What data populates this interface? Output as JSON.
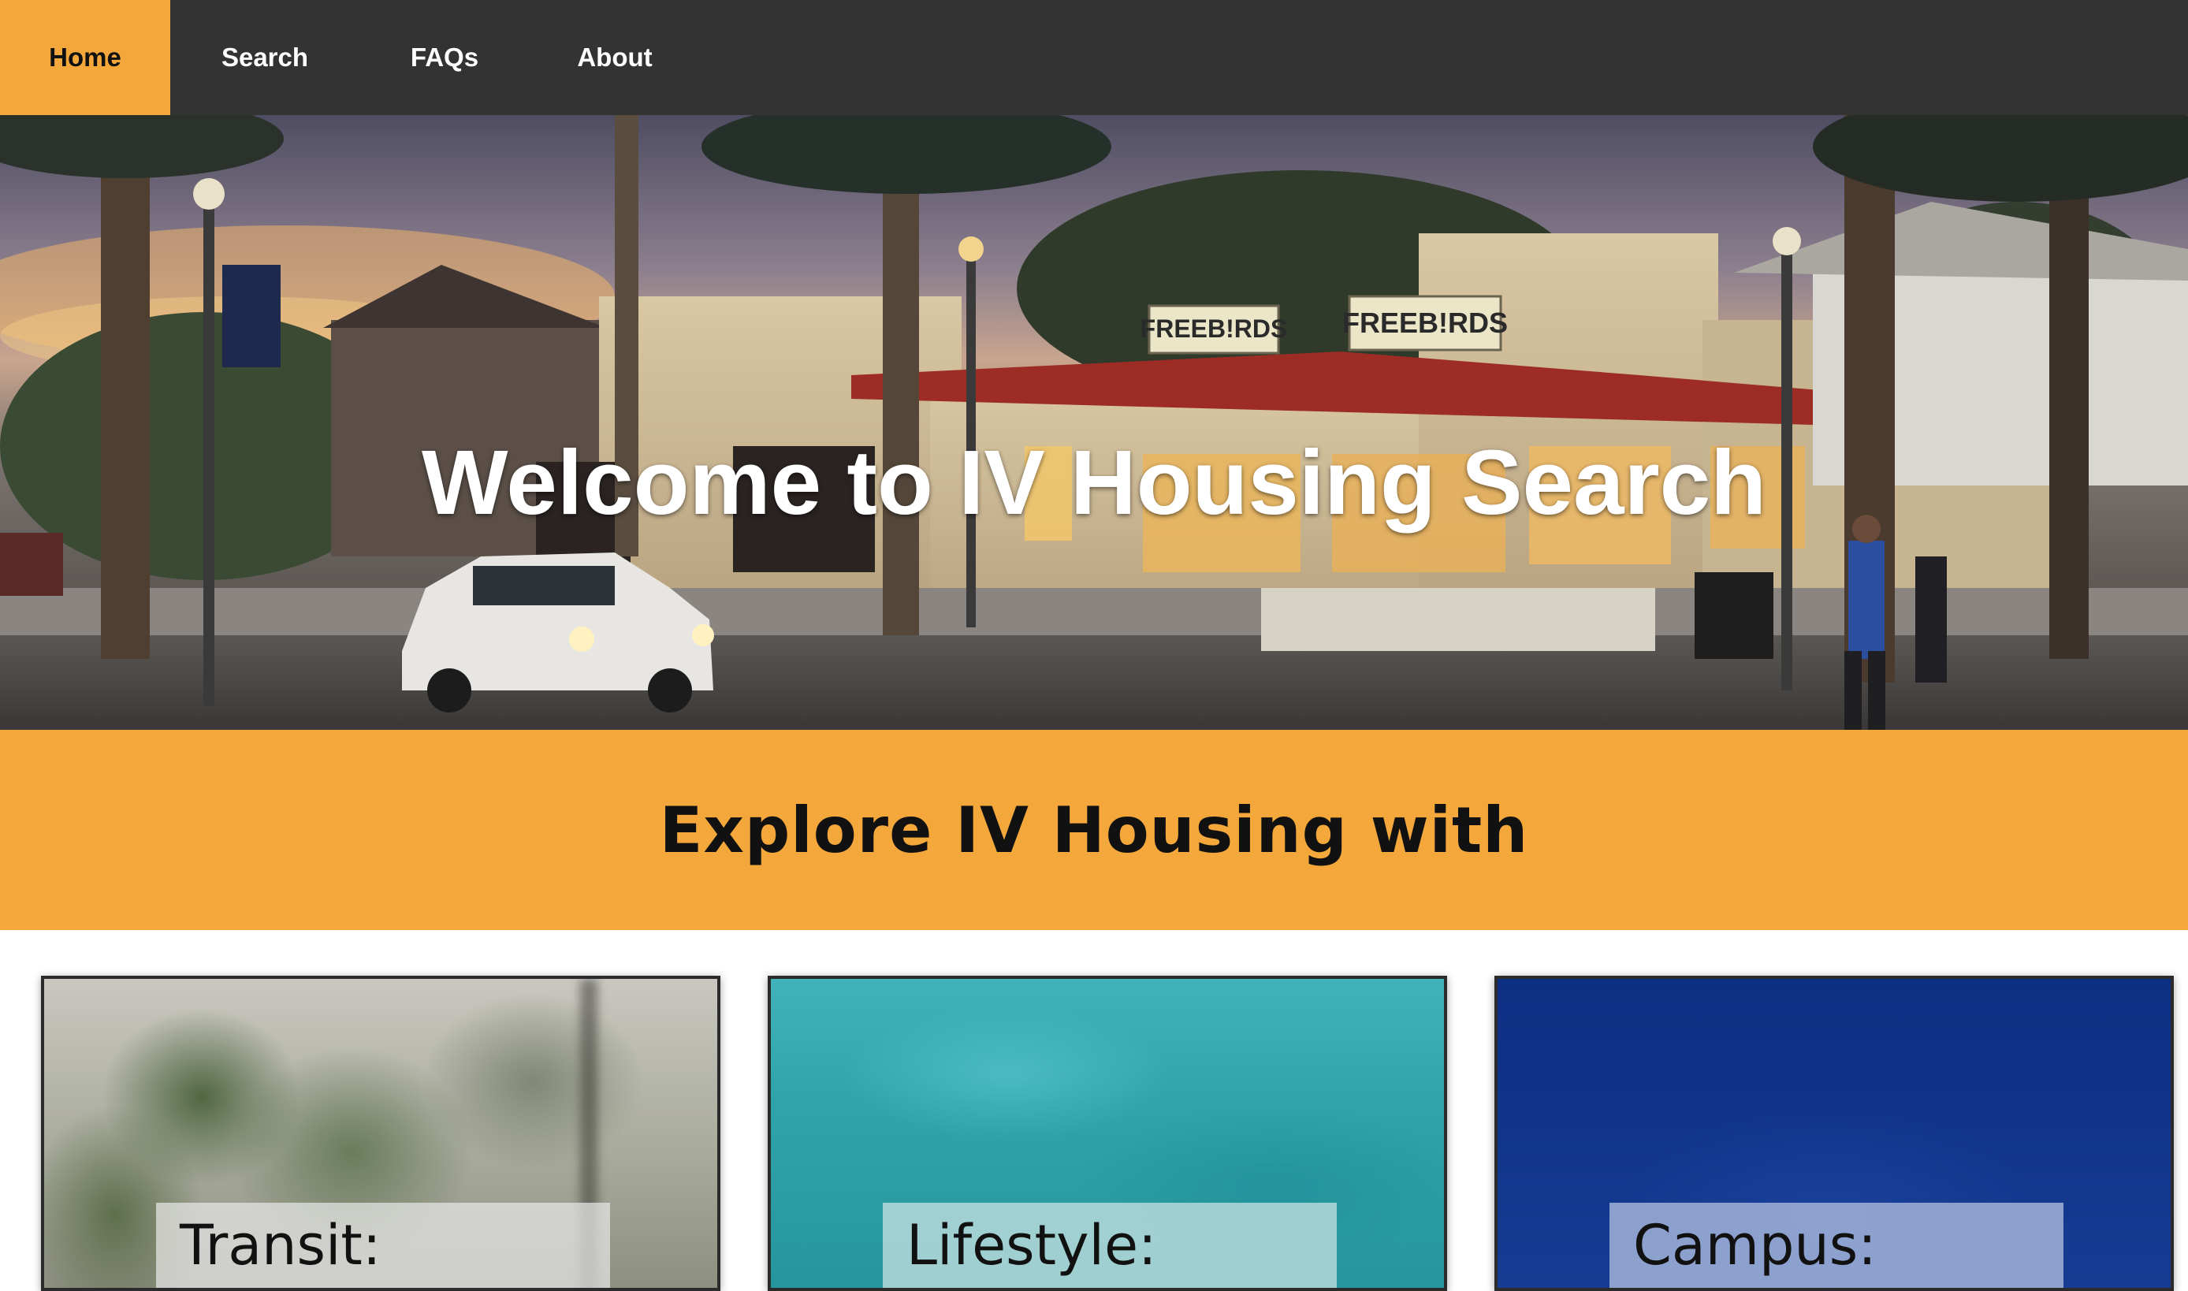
{
  "nav": {
    "items": [
      {
        "label": "Home",
        "active": true
      },
      {
        "label": "Search",
        "active": false
      },
      {
        "label": "FAQs",
        "active": false
      },
      {
        "label": "About",
        "active": false
      }
    ]
  },
  "hero": {
    "title": "Welcome to IV Housing Search",
    "signs": [
      "FREEB!RDS",
      "FREEB!RDS"
    ]
  },
  "explore": {
    "title": "Explore IV Housing with"
  },
  "cards": [
    {
      "label": "Transit:"
    },
    {
      "label": "Lifestyle:"
    },
    {
      "label": "Campus:"
    }
  ],
  "colors": {
    "nav_bg": "#333333",
    "accent": "#f4a83c",
    "text_dark": "#111111",
    "text_light": "#ffffff"
  }
}
